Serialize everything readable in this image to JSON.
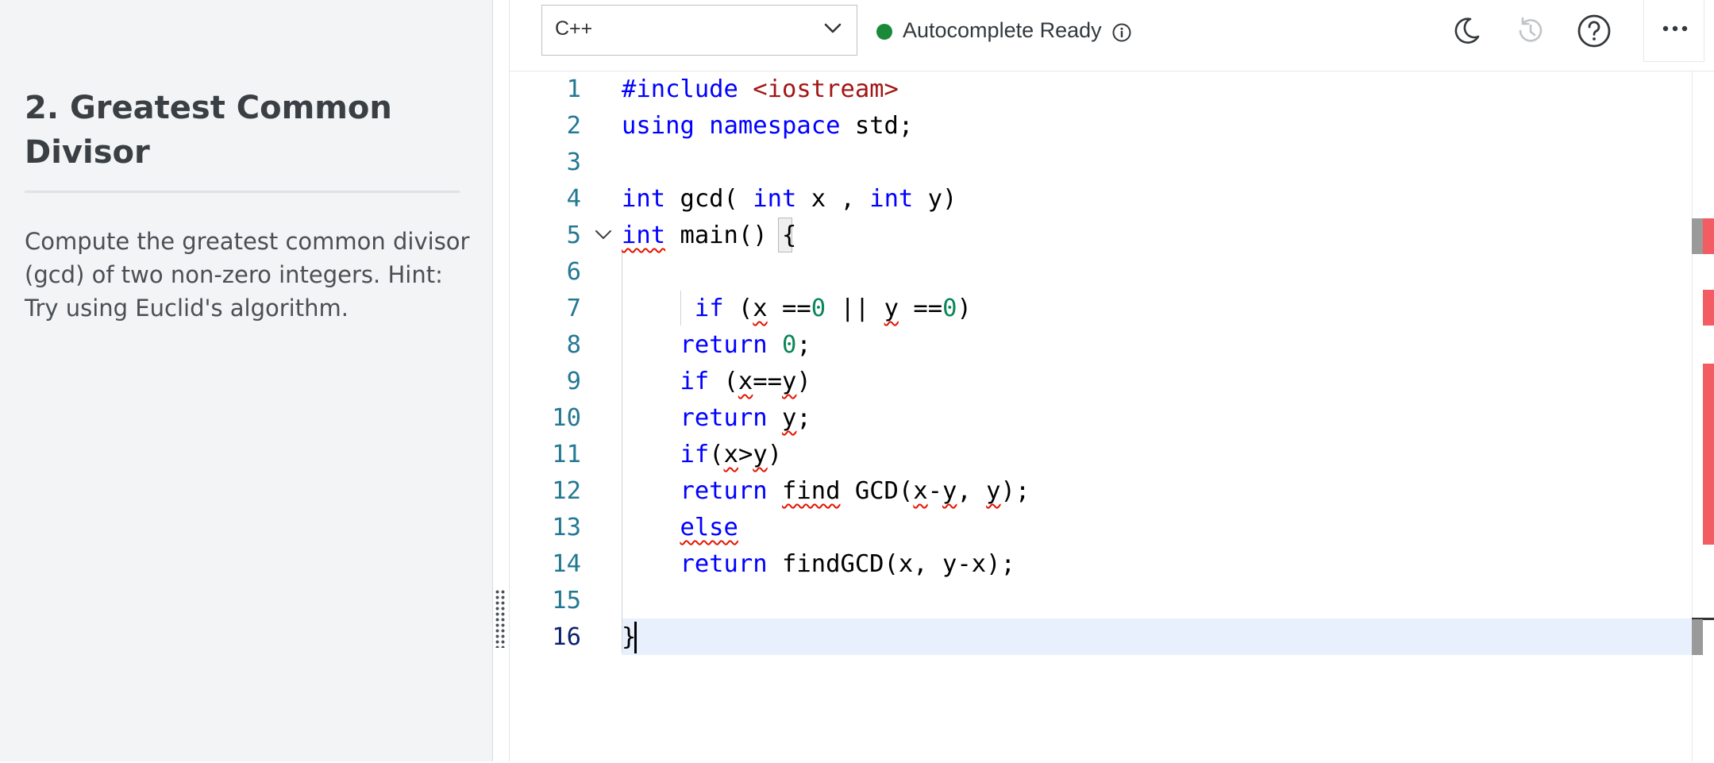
{
  "problem": {
    "title": "2. Greatest Common Divisor",
    "description": "Compute the greatest common divisor (gcd) of two non-zero integers. Hint: Try using Euclid's algorithm."
  },
  "toolbar": {
    "language": "C++",
    "status_text": "Autocomplete Ready",
    "status_color": "#1a8a3a",
    "icons": [
      "chevron-down-icon",
      "info-icon",
      "moon-icon",
      "history-icon",
      "help-icon",
      "more-icon"
    ]
  },
  "editor": {
    "line_numbers": [
      "1",
      "2",
      "3",
      "4",
      "5",
      "6",
      "7",
      "8",
      "9",
      "10",
      "11",
      "12",
      "13",
      "14",
      "15",
      "16"
    ],
    "current_line": "16",
    "lines": [
      "#include <iostream>",
      "using namespace std;",
      "",
      "int gcd( int x , int y)",
      "int main() {",
      "",
      "    if (x ==0 || y ==0)",
      "    return 0;",
      "    if (x==y)",
      "    return y;",
      "    if(x>y)",
      "    return find GCD(x-y, y);",
      "    else",
      "    return findGCD(x, y-x);",
      "",
      "}"
    ],
    "colors": {
      "keyword": "#0000ff",
      "string": "#a31515",
      "number": "#098658",
      "line_number": "#237893",
      "error_underline": "#e51400",
      "current_line_bg": "#e9f0fd"
    }
  }
}
